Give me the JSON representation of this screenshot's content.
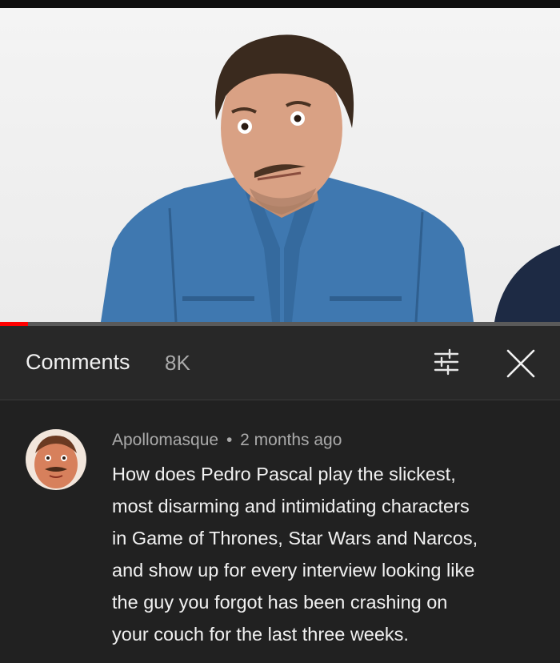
{
  "header": {
    "title": "Comments",
    "count": "8K",
    "filter_icon": "sort-filter-icon",
    "close_icon": "close-icon"
  },
  "video": {
    "progress_fraction": 0.05,
    "progress_color": "#ff0000"
  },
  "comment": {
    "author": "Apollomasque",
    "separator": "•",
    "time": "2 months ago",
    "lines": [
      "How does Pedro Pascal play the slickest,",
      "most disarming and intimidating characters",
      "in Game of Thrones, Star Wars and Narcos,",
      "and show up for every interview looking like",
      "the guy you forgot has been crashing on",
      "your couch for the last three weeks."
    ]
  },
  "colors": {
    "panel_bg": "#212121",
    "header_bg": "#282828",
    "text_primary": "#f1f1f1",
    "text_secondary": "#aaaaaa"
  }
}
